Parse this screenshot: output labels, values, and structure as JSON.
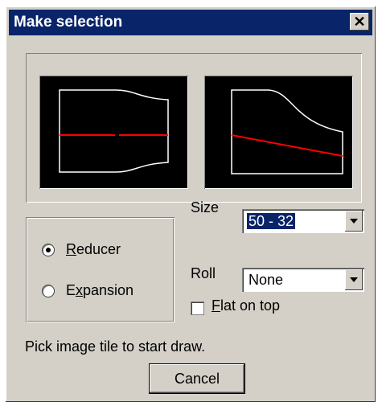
{
  "dialog": {
    "title": "Make selection",
    "close_label": "✕"
  },
  "preview": {
    "tiles": [
      {
        "name": "reducer-image-tile"
      },
      {
        "name": "eccentric-image-tile"
      }
    ],
    "colors": {
      "background": "#000000",
      "outline": "#ffffff",
      "centerline": "#ff0000"
    }
  },
  "type_group": {
    "options": [
      {
        "label_pre": "",
        "label_key": "R",
        "label_post": "educer",
        "checked": true
      },
      {
        "label_pre": "E",
        "label_key": "x",
        "label_post": "pansion",
        "checked": false
      }
    ]
  },
  "size": {
    "label": "Size",
    "value": "50 - 32"
  },
  "roll": {
    "label": "Roll",
    "value": "None"
  },
  "flat_on_top": {
    "label_key": "F",
    "label_rest": "lat on top",
    "checked": false
  },
  "status_text": "Pick image tile to start draw.",
  "cancel_label": "Cancel"
}
